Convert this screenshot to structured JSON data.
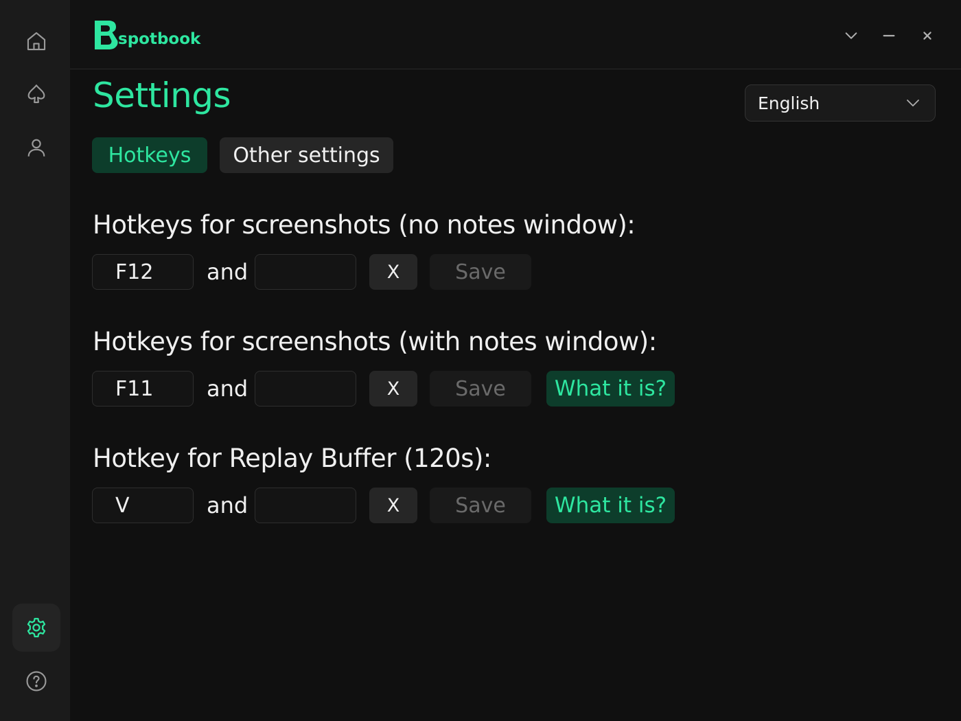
{
  "app": {
    "name": "spotbook"
  },
  "sidebar": {
    "items": [
      {
        "icon": "home-icon"
      },
      {
        "icon": "spade-icon"
      },
      {
        "icon": "user-icon"
      },
      {
        "icon": "gear-icon",
        "active": true
      },
      {
        "icon": "help-icon"
      }
    ]
  },
  "window_controls": [
    "chevron-down-icon",
    "minimize-icon",
    "close-icon"
  ],
  "page": {
    "title": "Settings"
  },
  "language": {
    "selected": "English"
  },
  "tabs": [
    {
      "label": "Hotkeys",
      "active": true
    },
    {
      "label": "Other settings",
      "active": false
    }
  ],
  "hotkeys": {
    "and_label": "and",
    "clear_label": "X",
    "save_label": "Save",
    "what_label": "What it is?",
    "groups": [
      {
        "title": "Hotkeys for screenshots (no notes window):",
        "key1": "F12",
        "key2": "",
        "has_info": false
      },
      {
        "title": "Hotkeys for screenshots (with notes window):",
        "key1": "F11",
        "key2": "",
        "has_info": true
      },
      {
        "title": "Hotkey for Replay Buffer (120s):",
        "key1": "V",
        "key2": "",
        "has_info": true
      }
    ]
  },
  "colors": {
    "accent": "#2ee6a0",
    "accent_bg": "#0d3d2b",
    "background": "#101010",
    "sidebar": "#1b1b1b"
  }
}
